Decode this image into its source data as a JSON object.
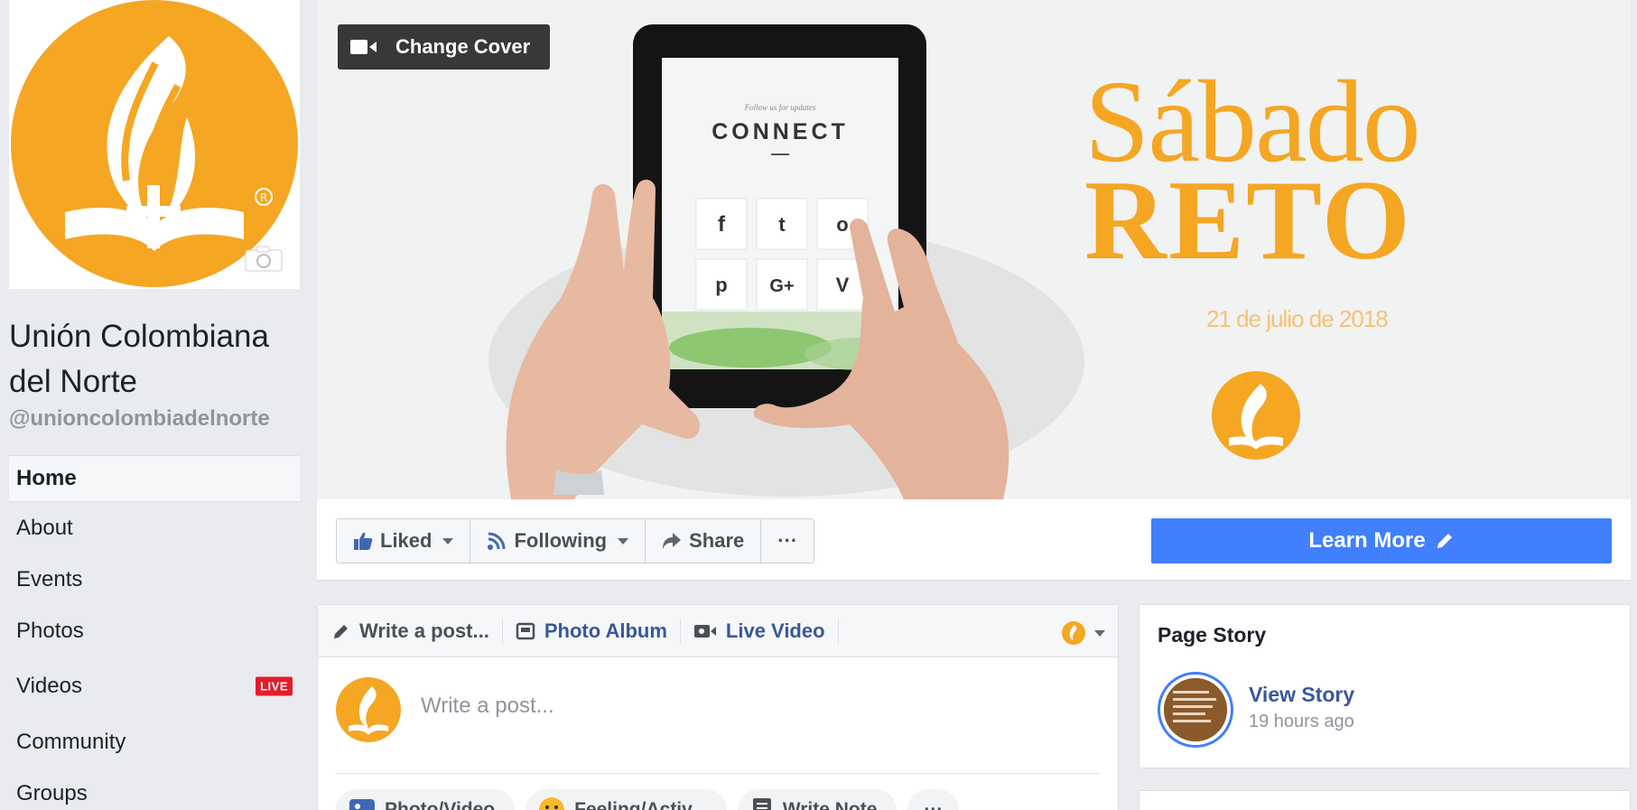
{
  "page": {
    "name": "Unión Colombiana del Norte",
    "handle": "@unioncolombiadelnorte"
  },
  "nav": [
    {
      "label": "Home",
      "active": true
    },
    {
      "label": "About"
    },
    {
      "label": "Events"
    },
    {
      "label": "Photos"
    },
    {
      "label": "Videos",
      "badge": "LIVE"
    },
    {
      "label": "Community"
    },
    {
      "label": "Groups"
    }
  ],
  "cover": {
    "change_cover_label": "Change Cover",
    "tablet_small_text": "Follow us for updates",
    "tablet_connect": "CONNECT",
    "tablet_icons": [
      "f",
      "t",
      "o",
      "p",
      "G+",
      "V"
    ],
    "headline_1": "Sábado",
    "headline_2": "RETO",
    "date": "21 de julio de 2018"
  },
  "actions": {
    "liked": "Liked",
    "following": "Following",
    "share": "Share",
    "more": "···",
    "learn_more": "Learn More"
  },
  "composer": {
    "tab_write": "Write a post...",
    "tab_album": "Photo Album",
    "tab_live": "Live Video",
    "placeholder": "Write a post...",
    "action_photo": "Photo/Video",
    "action_feeling": "Feeling/Activ...",
    "action_note": "Write Note",
    "action_more": "···"
  },
  "story": {
    "title": "Page Story",
    "link": "View Story",
    "time": "19 hours ago"
  },
  "colors": {
    "brand_orange": "#f5a623",
    "fb_blue": "#4080ff",
    "link_blue": "#385898",
    "live_red": "#e41c2c"
  }
}
